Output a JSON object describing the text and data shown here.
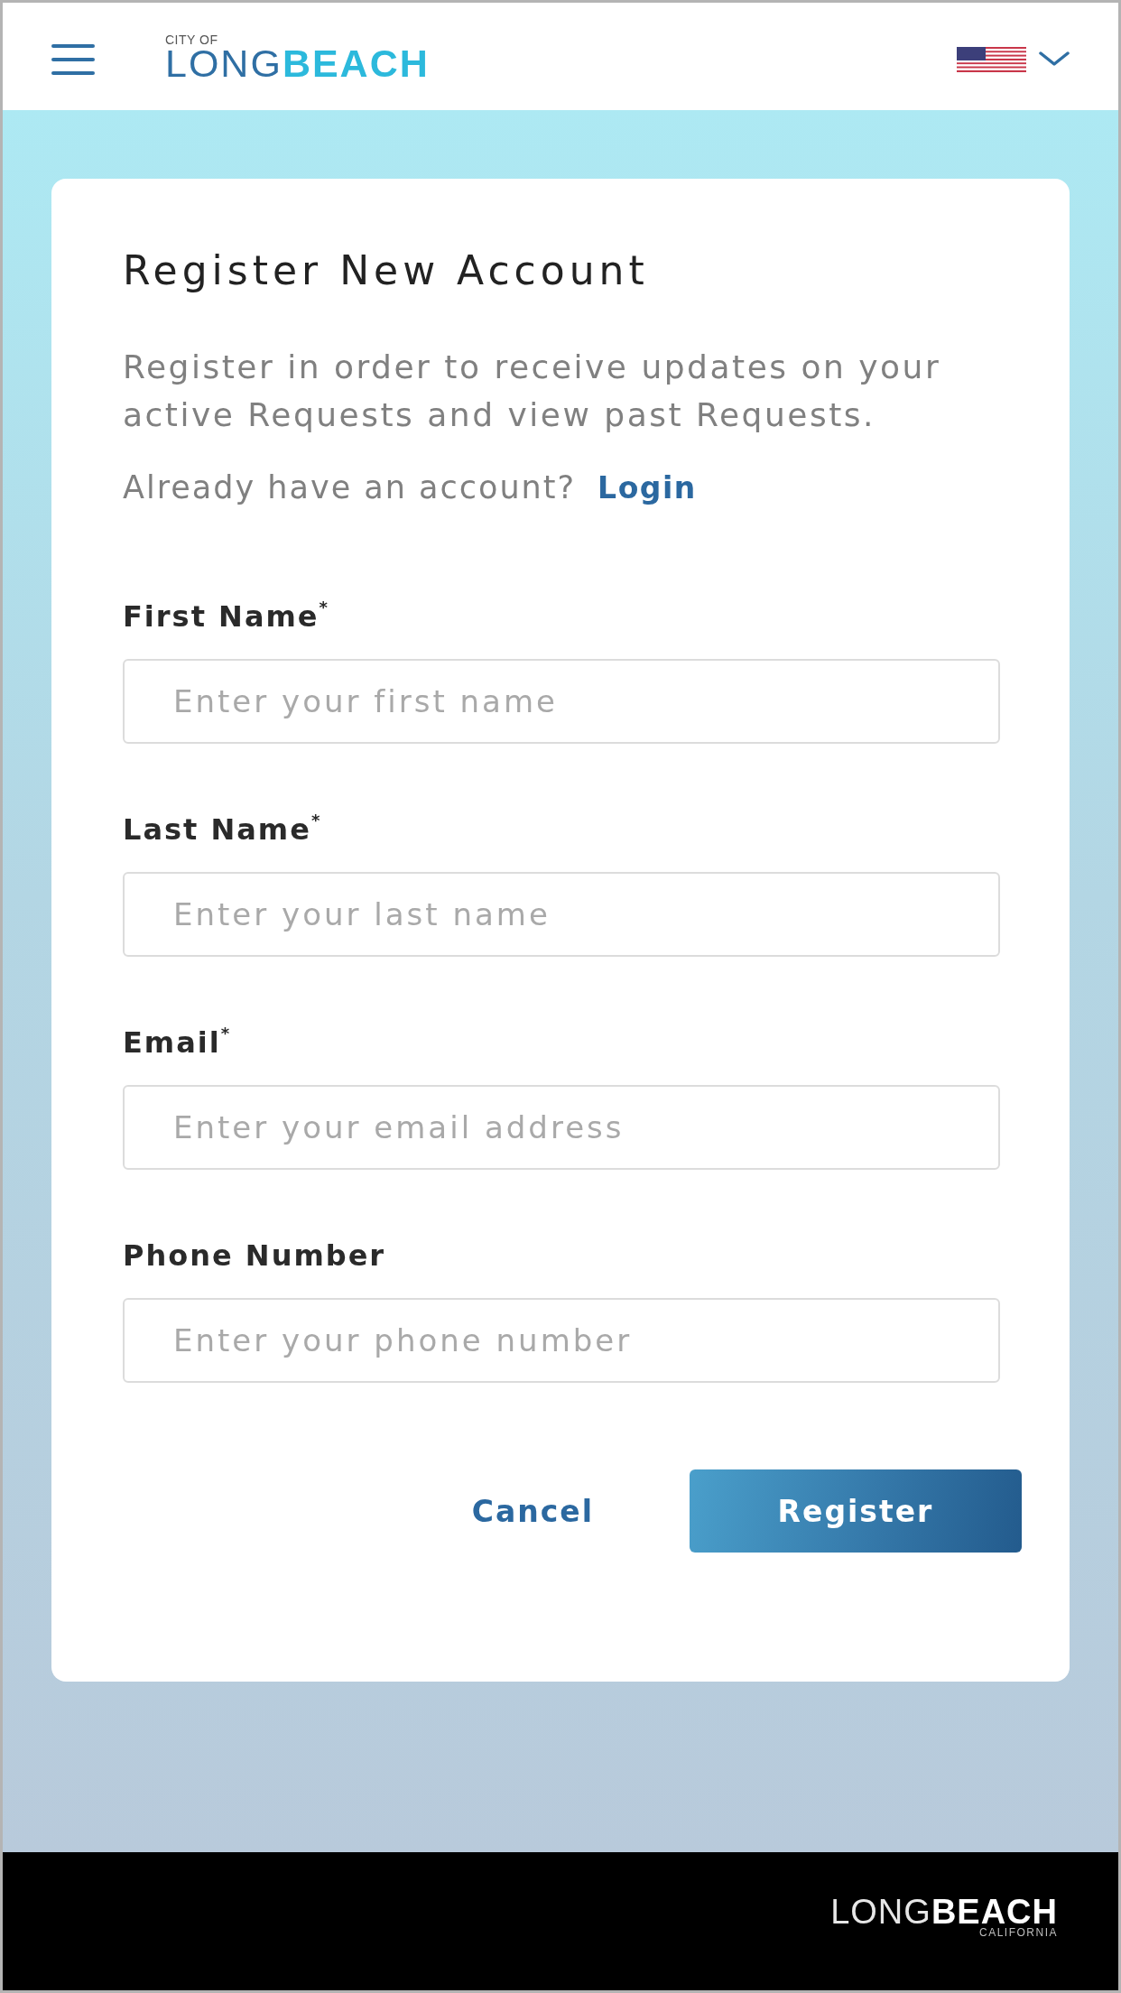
{
  "header": {
    "logo": {
      "top": "CITY OF",
      "wordmark": "LONG**BEACH**"
    }
  },
  "form": {
    "title": "Register New Account",
    "description": "Register in order to receive updates on your active Requests and view past Requests.",
    "login_prompt": "Already have an account?",
    "login_link": "Login",
    "fields": [
      {
        "label": "First Name$^{*}$",
        "placeholder": "Enter your first name"
      },
      {
        "label": "Last Name$^{*}$",
        "placeholder": "Enter your last name"
      },
      {
        "label": "Email$^{*}$",
        "placeholder": "Enter your email address"
      },
      {
        "label": "Phone Number",
        "placeholder": "Enter your phone number"
      }
    ],
    "buttons": [
      {
        "label": "Cancel",
        "kind": "secondary"
      },
      {
        "label": "Register",
        "kind": "primary"
      }
    ]
  },
  "footer": {
    "logo": {
      "wordmark": "LONG**BEACH**",
      "subtitle": "CALIFORNIA"
    }
  }
}
